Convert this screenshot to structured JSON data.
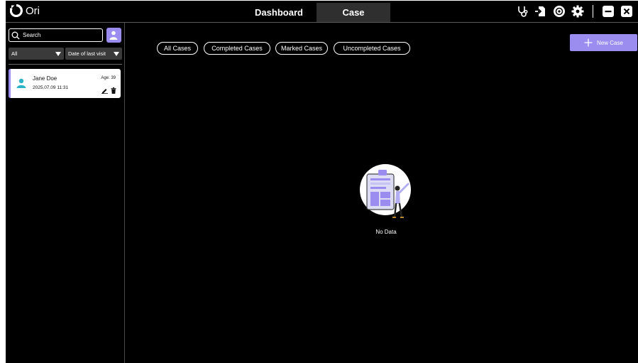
{
  "app": {
    "name": "Ori"
  },
  "nav": {
    "tabs": [
      {
        "label": "Dashboard"
      },
      {
        "label": "Case"
      }
    ]
  },
  "toolbar": {
    "icons": [
      "stethoscope-icon",
      "export-icon",
      "network-icon",
      "settings-icon",
      "minimize-icon",
      "close-icon"
    ]
  },
  "sidebar": {
    "search_placeholder": "Search",
    "filter_all": "All",
    "filter_sort": "Date of last visit",
    "patients": [
      {
        "name": "Jane Doe",
        "age": "Age: 39",
        "date": "2025.07.09 11:31"
      }
    ]
  },
  "main": {
    "filters": [
      {
        "label": "All Cases"
      },
      {
        "label": "Completed Cases"
      },
      {
        "label": "Marked Cases"
      },
      {
        "label": "Uncompleted Cases"
      }
    ],
    "new_case_label": "New Case",
    "empty_label": "No Data"
  },
  "colors": {
    "accent": "#9b8cf0",
    "background": "#000000",
    "tab_active": "#2f2f2f",
    "patient_icon": "#2bb3c9"
  }
}
